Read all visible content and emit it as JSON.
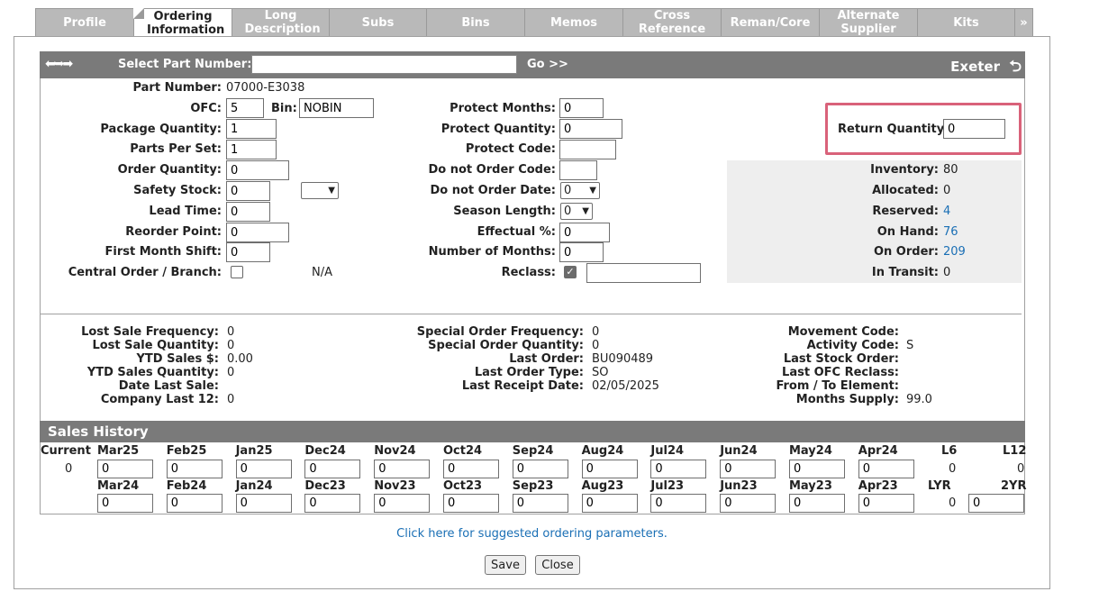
{
  "tabs": [
    {
      "label": "Profile",
      "active": false
    },
    {
      "label": "Ordering Information",
      "active": true
    },
    {
      "label": "Long Description",
      "active": false
    },
    {
      "label": "Subs",
      "active": false
    },
    {
      "label": "Bins",
      "active": false
    },
    {
      "label": "Memos",
      "active": false
    },
    {
      "label": "Cross Reference",
      "active": false
    },
    {
      "label": "Reman/Core",
      "active": false
    },
    {
      "label": "Alternate Supplier",
      "active": false
    },
    {
      "label": "Kits",
      "active": false
    },
    {
      "label": "»",
      "active": false
    }
  ],
  "part_bar": {
    "label": "Select Part Number:",
    "value": "",
    "go": "Go >>",
    "location": "Exeter"
  },
  "form": {
    "part_number_label": "Part Number:",
    "part_number": "07000-E3038",
    "ofc_label": "OFC:",
    "ofc": "5",
    "bin_label": "Bin:",
    "bin": "NOBIN",
    "package_qty_label": "Package Quantity:",
    "package_qty": "1",
    "parts_per_set_label": "Parts Per Set:",
    "parts_per_set": "1",
    "order_qty_label": "Order Quantity:",
    "order_qty": "0",
    "safety_stock_label": "Safety Stock:",
    "safety_stock": "0",
    "safety_stock_select": "",
    "lead_time_label": "Lead Time:",
    "lead_time": "0",
    "reorder_point_label": "Reorder Point:",
    "reorder_point": "0",
    "first_month_shift_label": "First Month Shift:",
    "first_month_shift": "0",
    "central_order_label": "Central Order / Branch:",
    "central_order_na": "N/A",
    "protect_months_label": "Protect Months:",
    "protect_months": "0",
    "protect_qty_label": "Protect Quantity:",
    "protect_qty": "0",
    "protect_code_label": "Protect Code:",
    "protect_code": "",
    "do_not_order_code_label": "Do not Order Code:",
    "do_not_order_code": "",
    "do_not_order_date_label": "Do not Order Date:",
    "do_not_order_date": "0",
    "season_length_label": "Season Length:",
    "season_length": "0",
    "effectual_label": "Effectual %:",
    "effectual": "0",
    "num_months_label": "Number of Months:",
    "num_months": "0",
    "reclass_label": "Reclass:",
    "reclass_value": "",
    "return_qty_label": "Return Quantity:",
    "return_qty": "0"
  },
  "inventory": {
    "inventory_label": "Inventory:",
    "inventory": "80",
    "allocated_label": "Allocated:",
    "allocated": "0",
    "reserved_label": "Reserved:",
    "reserved": "4",
    "on_hand_label": "On Hand:",
    "on_hand": "76",
    "on_order_label": "On Order:",
    "on_order": "209",
    "in_transit_label": "In Transit:",
    "in_transit": "0"
  },
  "stats": {
    "col1": [
      {
        "label": "Lost Sale Frequency:",
        "value": "0"
      },
      {
        "label": "Lost Sale Quantity:",
        "value": "0"
      },
      {
        "label": "YTD Sales $:",
        "value": "0.00"
      },
      {
        "label": "YTD Sales Quantity:",
        "value": "0"
      },
      {
        "label": "Date Last Sale:",
        "value": ""
      },
      {
        "label": "Company Last 12:",
        "value": "0"
      }
    ],
    "col2": [
      {
        "label": "Special Order Frequency:",
        "value": "0"
      },
      {
        "label": "Special Order Quantity:",
        "value": "0"
      },
      {
        "label": "Last Order:",
        "value": "BU090489"
      },
      {
        "label": "Last Order Type:",
        "value": "SO"
      },
      {
        "label": "Last Receipt Date:",
        "value": "02/05/2025"
      }
    ],
    "col3": [
      {
        "label": "Movement Code:",
        "value": ""
      },
      {
        "label": "Activity Code:",
        "value": "S"
      },
      {
        "label": "Last Stock Order:",
        "value": ""
      },
      {
        "label": "Last OFC Reclass:",
        "value": ""
      },
      {
        "label": "From / To Element:",
        "value": ""
      },
      {
        "label": "Months Supply:",
        "value": "99.0"
      }
    ]
  },
  "sales_history": {
    "title": "Sales History",
    "current_label": "Current",
    "current_value": "0",
    "row1_months": [
      "Mar25",
      "Feb25",
      "Jan25",
      "Dec24",
      "Nov24",
      "Oct24",
      "Sep24",
      "Aug24",
      "Jul24",
      "Jun24",
      "May24",
      "Apr24"
    ],
    "row1_values": [
      "0",
      "0",
      "0",
      "0",
      "0",
      "0",
      "0",
      "0",
      "0",
      "0",
      "0",
      "0"
    ],
    "row2_months": [
      "Mar24",
      "Feb24",
      "Jan24",
      "Dec23",
      "Nov23",
      "Oct23",
      "Sep23",
      "Aug23",
      "Jul23",
      "Jun23",
      "May23",
      "Apr23"
    ],
    "row2_values": [
      "0",
      "0",
      "0",
      "0",
      "0",
      "0",
      "0",
      "0",
      "0",
      "0",
      "0",
      "0"
    ],
    "l6_label": "L6",
    "l6_value": "0",
    "l12_label": "L12",
    "l12_value": "0",
    "lyr_label": "LYR",
    "lyr_value": "0",
    "yr2_label": "2YR",
    "yr2_value": "0"
  },
  "footer": {
    "suggest_link": "Click here for suggested ordering parameters.",
    "save_label": "Save",
    "close_label": "Close"
  }
}
